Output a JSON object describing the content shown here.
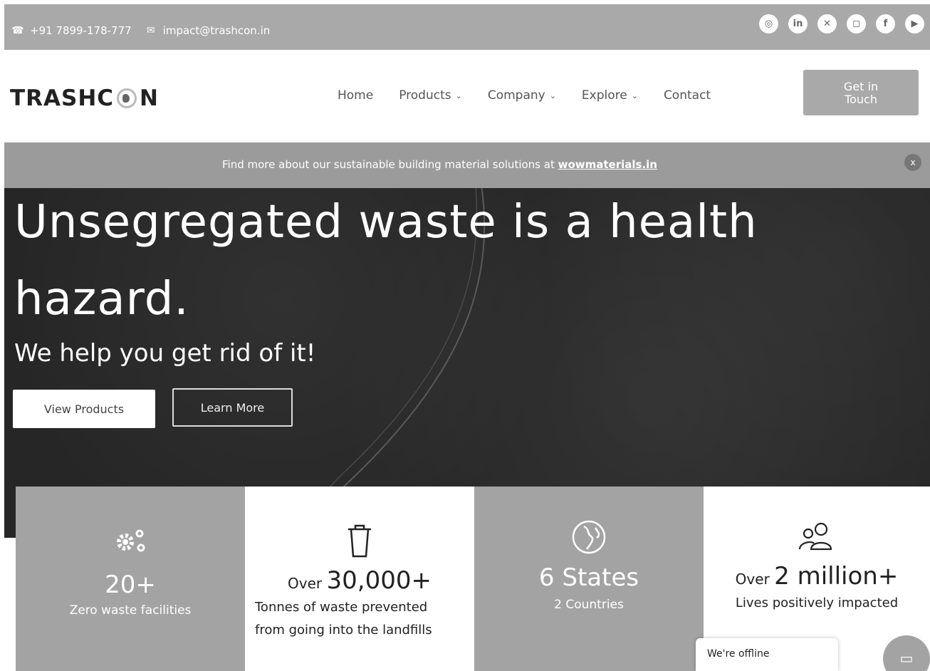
{
  "topbar": {
    "phone": "+91 7899-178-777",
    "email": "impact@trashcon.in",
    "socials": [
      "whatsapp-icon",
      "linkedin-icon",
      "x-icon",
      "instagram-icon",
      "facebook-icon",
      "youtube-icon"
    ]
  },
  "header": {
    "logo_left": "TRASHC",
    "logo_right": "N",
    "nav": [
      {
        "label": "Home",
        "dropdown": false
      },
      {
        "label": "Products",
        "dropdown": true
      },
      {
        "label": "Company",
        "dropdown": true
      },
      {
        "label": "Explore",
        "dropdown": true
      },
      {
        "label": "Contact",
        "dropdown": false
      }
    ],
    "cta_line1": "Get in",
    "cta_line2": "Touch"
  },
  "banner": {
    "text": "Find more about our sustainable building material solutions at ",
    "link": "wowmaterials.in",
    "close": "x"
  },
  "hero": {
    "headline": "Unsegregated waste is a health hazard.",
    "subheadline": "We help you get rid of it!",
    "primary_button": "View Products",
    "secondary_button": "Learn More"
  },
  "stats": [
    {
      "pre": "",
      "value": "20+",
      "desc": "Zero waste facilities",
      "icon": "gears-icon"
    },
    {
      "pre": "Over ",
      "value": "30,000+",
      "desc_line1": "Tonnes of waste prevented",
      "desc_line2": "from going into the landfills",
      "icon": "trash-can-icon"
    },
    {
      "pre": "",
      "value": "6 States",
      "desc": "2 Countries",
      "icon": "globe-icon"
    },
    {
      "pre": "Over ",
      "value": "2 million+",
      "desc": "Lives positively impacted",
      "icon": "people-icon"
    }
  ],
  "chat": {
    "status": "We're offline"
  },
  "colors": {
    "gray_panel": "#a3a3a3",
    "hero_bg": "#262626"
  }
}
